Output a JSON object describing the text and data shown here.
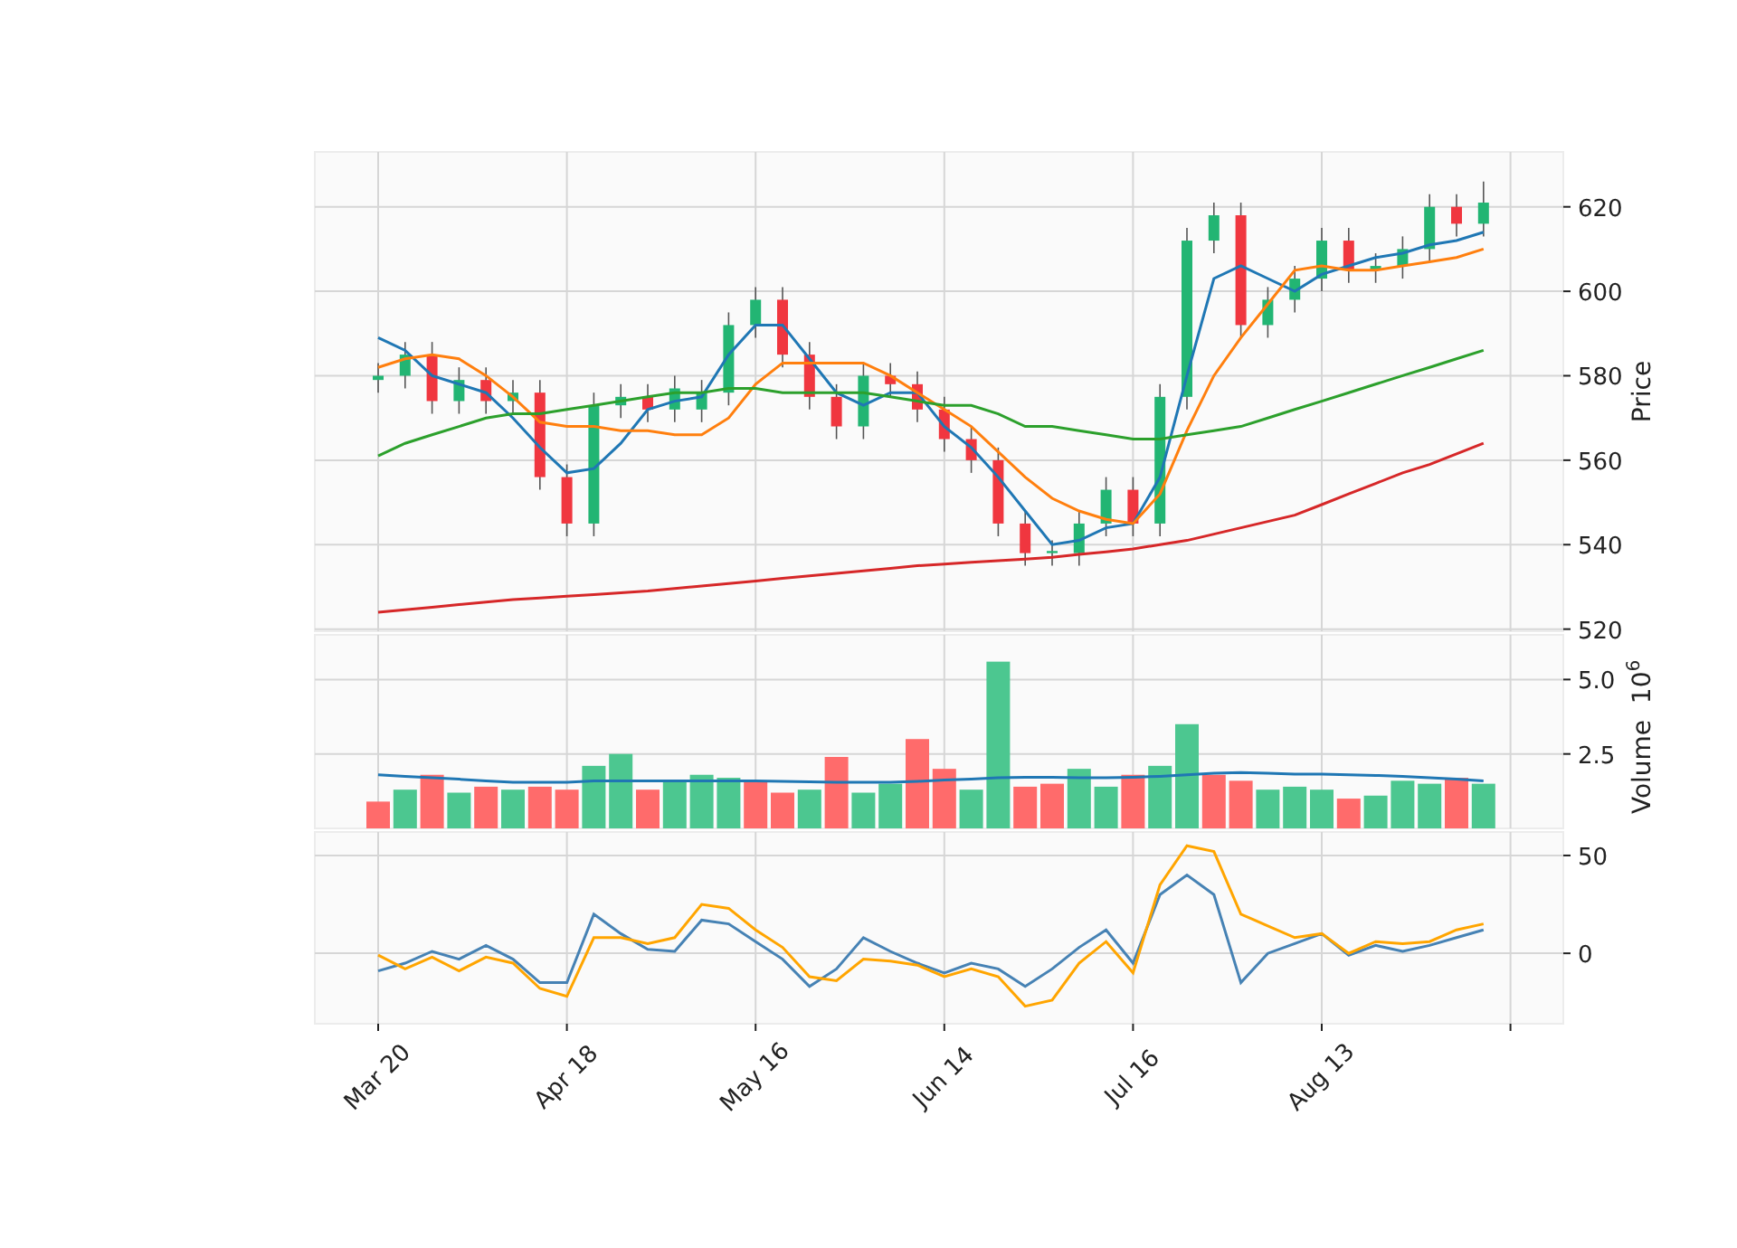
{
  "charts": [
    {
      "kind": "price",
      "chart_data": {
        "type": "candlestick",
        "grid": true,
        "ylabel": "Price",
        "ylim": [
          519.5,
          633
        ],
        "yticks": [
          {
            "value": 520,
            "label": "520"
          },
          {
            "value": 540,
            "label": "540"
          },
          {
            "value": 560,
            "label": "560"
          },
          {
            "value": 580,
            "label": "580"
          },
          {
            "value": 600,
            "label": "600"
          },
          {
            "value": 620,
            "label": "620"
          }
        ],
        "series": [
          {
            "type": "candlestick",
            "color": "#22b573",
            "ohlc": [
              [
                579,
                583,
                576,
                580
              ],
              [
                580,
                588,
                577,
                585
              ],
              null,
              [
                574,
                582,
                571,
                579
              ],
              null,
              [
                574,
                579,
                571,
                576
              ],
              null,
              null,
              [
                545,
                576,
                542,
                573
              ],
              [
                573,
                578,
                570,
                575
              ],
              null,
              [
                572,
                580,
                569,
                577
              ],
              [
                572,
                579,
                569,
                576
              ],
              [
                576,
                595,
                573,
                592
              ],
              [
                592,
                601,
                589,
                598
              ],
              null,
              null,
              null,
              [
                568,
                583,
                565,
                580
              ],
              null,
              null,
              null,
              null,
              null,
              null,
              [
                538,
                541,
                535,
                538.5
              ],
              [
                538,
                548,
                535,
                545
              ],
              [
                545,
                556,
                542,
                553
              ],
              null,
              [
                545,
                578,
                542,
                575
              ],
              [
                575,
                615,
                572,
                612
              ],
              [
                612,
                621,
                609,
                618
              ],
              null,
              [
                592,
                601,
                589,
                598
              ],
              [
                598,
                606,
                595,
                603
              ],
              [
                603,
                615,
                600,
                612
              ],
              null,
              [
                605,
                609,
                602,
                606
              ],
              [
                606,
                613,
                603,
                610
              ],
              [
                610,
                623,
                607,
                620
              ],
              null,
              [
                616,
                626,
                613,
                621
              ]
            ]
          },
          {
            "type": "candlestick",
            "color": "#f0363f",
            "ohlc": [
              null,
              null,
              [
                585,
                588,
                571,
                574
              ],
              null,
              [
                579,
                582,
                571,
                574
              ],
              null,
              [
                576,
                579,
                553,
                556
              ],
              [
                556,
                559,
                542,
                545
              ],
              null,
              null,
              [
                575,
                578,
                569,
                572
              ],
              null,
              null,
              null,
              null,
              [
                598,
                601,
                582,
                585
              ],
              [
                585,
                588,
                572,
                575
              ],
              [
                575,
                578,
                565,
                568
              ],
              null,
              [
                580,
                583,
                575,
                578
              ],
              [
                578,
                581,
                569,
                572
              ],
              [
                572,
                575,
                562,
                565
              ],
              [
                565,
                568,
                557,
                560
              ],
              [
                560,
                563,
                542,
                545
              ],
              [
                545,
                548,
                535,
                538
              ],
              null,
              null,
              null,
              [
                553,
                556,
                542,
                545
              ],
              null,
              null,
              null,
              [
                618,
                621,
                589,
                592
              ],
              null,
              null,
              null,
              [
                612,
                615,
                602,
                605
              ],
              null,
              null,
              null,
              [
                620,
                623,
                613,
                616
              ],
              null
            ]
          },
          {
            "type": "line",
            "color": "#1f77b4",
            "values": [
              589,
              586,
              580,
              578,
              576,
              570,
              563,
              557,
              558,
              564,
              572,
              574,
              575,
              585,
              592,
              592,
              584,
              576,
              573,
              576,
              576,
              568,
              563,
              556,
              548,
              540,
              541,
              544,
              545,
              556,
              580,
              603,
              606,
              603,
              600,
              604,
              606,
              608,
              609,
              611,
              612,
              614
            ]
          },
          {
            "type": "line",
            "color": "#ff7f0e",
            "values": [
              582,
              584,
              585,
              584,
              580,
              575,
              569,
              568,
              568,
              567,
              567,
              566,
              566,
              570,
              578,
              583,
              583,
              583,
              583,
              580,
              576,
              572,
              568,
              562,
              556,
              551,
              548,
              546,
              545,
              552,
              567,
              580,
              589,
              597,
              605,
              606,
              605,
              605,
              606,
              607,
              608,
              610
            ]
          },
          {
            "type": "line",
            "color": "#2ca02c",
            "values": [
              561,
              564,
              566,
              568,
              570,
              571,
              571,
              572,
              573,
              574,
              575,
              576,
              576,
              577,
              577,
              576,
              576,
              576,
              576,
              575,
              574,
              573,
              573,
              571,
              568,
              568,
              567,
              566,
              565,
              565,
              566,
              567,
              568,
              570,
              572,
              574,
              576,
              578,
              580,
              582,
              584,
              586
            ]
          },
          {
            "type": "line",
            "color": "#d62728",
            "values": [
              524,
              524.6,
              525.2,
              525.8,
              526.4,
              527,
              527.4,
              527.8,
              528.2,
              528.6,
              529,
              529.6,
              530.2,
              530.8,
              531.4,
              532,
              532.6,
              533.2,
              533.8,
              534.4,
              535,
              535.4,
              535.8,
              536.2,
              536.6,
              537,
              537.7,
              538.3,
              539,
              540,
              541,
              542.5,
              544,
              545.5,
              547,
              549.5,
              552,
              554.5,
              557,
              559,
              561.5,
              564
            ]
          }
        ]
      }
    },
    {
      "kind": "volume",
      "scale_label": {
        "base": "10",
        "exponent": "6"
      },
      "chart_data": {
        "type": "bar",
        "grid": true,
        "ylabel": "Volume",
        "ylim": [
          0,
          6.5
        ],
        "yticks": [
          {
            "value": 2.5,
            "label": "2.5"
          },
          {
            "value": 5,
            "label": "5.0"
          }
        ],
        "series": [
          {
            "type": "bar",
            "color": "#4cc790",
            "values": [
              null,
              1.3,
              null,
              1.2,
              null,
              1.3,
              null,
              null,
              2.1,
              2.5,
              null,
              1.6,
              1.8,
              1.7,
              null,
              null,
              1.3,
              null,
              1.2,
              1.5,
              null,
              null,
              1.3,
              5.6,
              null,
              null,
              2.0,
              1.4,
              null,
              2.1,
              3.5,
              null,
              null,
              1.3,
              1.4,
              1.3,
              null,
              1.1,
              1.6,
              1.5,
              null,
              1.5
            ]
          },
          {
            "type": "bar",
            "color": "#ff6b6b",
            "values": [
              0.9,
              null,
              1.8,
              null,
              1.4,
              null,
              1.4,
              1.3,
              null,
              null,
              1.3,
              null,
              null,
              null,
              1.6,
              1.2,
              null,
              2.4,
              null,
              null,
              3.0,
              2.0,
              null,
              null,
              1.4,
              1.5,
              null,
              null,
              1.8,
              null,
              null,
              1.8,
              1.6,
              null,
              null,
              null,
              1.0,
              null,
              null,
              null,
              1.7,
              null
            ]
          },
          {
            "type": "line",
            "color": "#1f77b4",
            "values": [
              1.8,
              1.75,
              1.7,
              1.65,
              1.6,
              1.55,
              1.55,
              1.55,
              1.6,
              1.6,
              1.6,
              1.6,
              1.6,
              1.6,
              1.6,
              1.58,
              1.56,
              1.55,
              1.55,
              1.55,
              1.58,
              1.62,
              1.66,
              1.7,
              1.72,
              1.72,
              1.7,
              1.7,
              1.72,
              1.75,
              1.8,
              1.85,
              1.88,
              1.85,
              1.82,
              1.82,
              1.8,
              1.78,
              1.75,
              1.7,
              1.65,
              1.6
            ]
          }
        ]
      }
    },
    {
      "kind": "oscillator",
      "chart_data": {
        "type": "line",
        "grid": true,
        "ylim": [
          -36,
          62
        ],
        "yticks": [
          {
            "value": 0,
            "label": "0"
          },
          {
            "value": 50,
            "label": "50"
          }
        ],
        "categories": [
          "Mar 20",
          null,
          null,
          null,
          null,
          null,
          null,
          "Apr 18",
          null,
          null,
          null,
          null,
          null,
          null,
          "May 16",
          null,
          null,
          null,
          null,
          null,
          null,
          "Jun 14",
          null,
          null,
          null,
          null,
          null,
          null,
          "Jul 16",
          null,
          null,
          null,
          null,
          null,
          null,
          "Aug 13",
          null,
          null,
          null,
          null,
          null,
          null,
          null
        ],
        "series": [
          {
            "color": "#4682b4",
            "values": [
              -9,
              -5,
              1,
              -3,
              4,
              -3,
              -15,
              -15,
              20,
              10,
              2,
              1,
              17,
              15,
              6,
              -3,
              -17,
              -8,
              8,
              1,
              -5,
              -10,
              -5,
              -8,
              -17,
              -8,
              3,
              12,
              -5,
              30,
              40,
              30,
              -15,
              0,
              5,
              10,
              -1,
              4,
              1,
              4,
              8,
              12,
              null
            ]
          },
          {
            "color": "#ffa500",
            "values": [
              -1,
              -8,
              -2,
              -9,
              -2,
              -5,
              -18,
              -22,
              8,
              8,
              5,
              8,
              25,
              23,
              12,
              3,
              -12,
              -14,
              -3,
              -4,
              -6,
              -12,
              -8,
              -12,
              -27,
              -24,
              -5,
              6,
              -10,
              35,
              55,
              52,
              20,
              14,
              8,
              10,
              0,
              6,
              5,
              6,
              12,
              15,
              null
            ]
          }
        ]
      }
    }
  ]
}
